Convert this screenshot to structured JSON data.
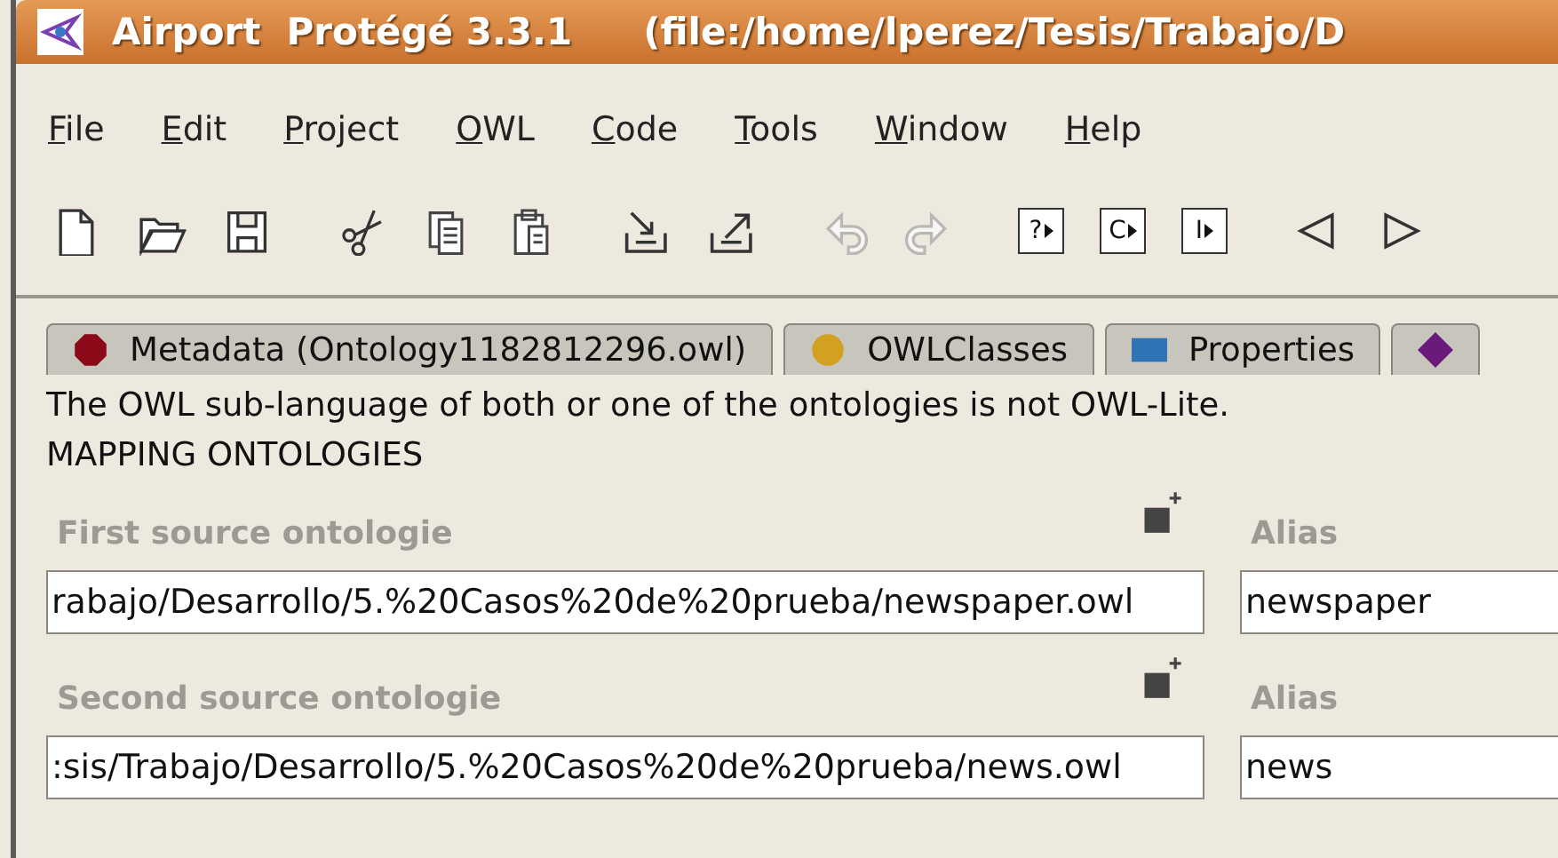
{
  "window": {
    "title": "Airport  Protégé 3.3.1",
    "path": "(file:/home/lperez/Tesis/Trabajo/D"
  },
  "menu": [
    "File",
    "Edit",
    "Project",
    "OWL",
    "Code",
    "Tools",
    "Window",
    "Help"
  ],
  "toolbar": [
    [
      {
        "kind": "new",
        "disabled": false
      },
      {
        "kind": "open",
        "disabled": false
      },
      {
        "kind": "save",
        "disabled": false
      }
    ],
    [
      {
        "kind": "cut",
        "disabled": false
      },
      {
        "kind": "copy",
        "disabled": false
      },
      {
        "kind": "paste",
        "disabled": false
      }
    ],
    [
      {
        "kind": "import",
        "disabled": false
      },
      {
        "kind": "export",
        "disabled": false
      }
    ],
    [
      {
        "kind": "undo",
        "disabled": true
      },
      {
        "kind": "redo",
        "disabled": true
      }
    ],
    [
      {
        "kind": "box",
        "label": "?",
        "disabled": false
      },
      {
        "kind": "box",
        "label": "C",
        "disabled": false
      },
      {
        "kind": "box",
        "label": "I",
        "disabled": false
      }
    ],
    [
      {
        "kind": "back",
        "disabled": false
      },
      {
        "kind": "forward",
        "disabled": false
      }
    ]
  ],
  "tabs": [
    {
      "label": "Metadata (Ontology1182812296.owl)",
      "kind": "octagon",
      "color": "#8b0a1a",
      "selected": false
    },
    {
      "label": "OWLClasses",
      "kind": "circle",
      "color": "#d4a020",
      "selected": false
    },
    {
      "label": "Properties",
      "kind": "rect",
      "color": "#2e74b5",
      "selected": false
    },
    {
      "kind": "diamond",
      "color": "#6a1a7a",
      "selected": false
    }
  ],
  "messages": [
    "The OWL sub-language of both or one of the ontologies is not OWL-Lite.",
    "MAPPING ONTOLOGIES"
  ],
  "sources": [
    {
      "label": "First source ontologie",
      "value": "rabajo/Desarrollo/5.%20Casos%20de%20prueba/newspaper.owl",
      "alias_label": "Alias",
      "alias": "newspaper"
    },
    {
      "label": "Second source ontologie",
      "value": ":sis/Trabajo/Desarrollo/5.%20Casos%20de%20prueba/news.owl",
      "alias_label": "Alias",
      "alias": "news"
    }
  ]
}
